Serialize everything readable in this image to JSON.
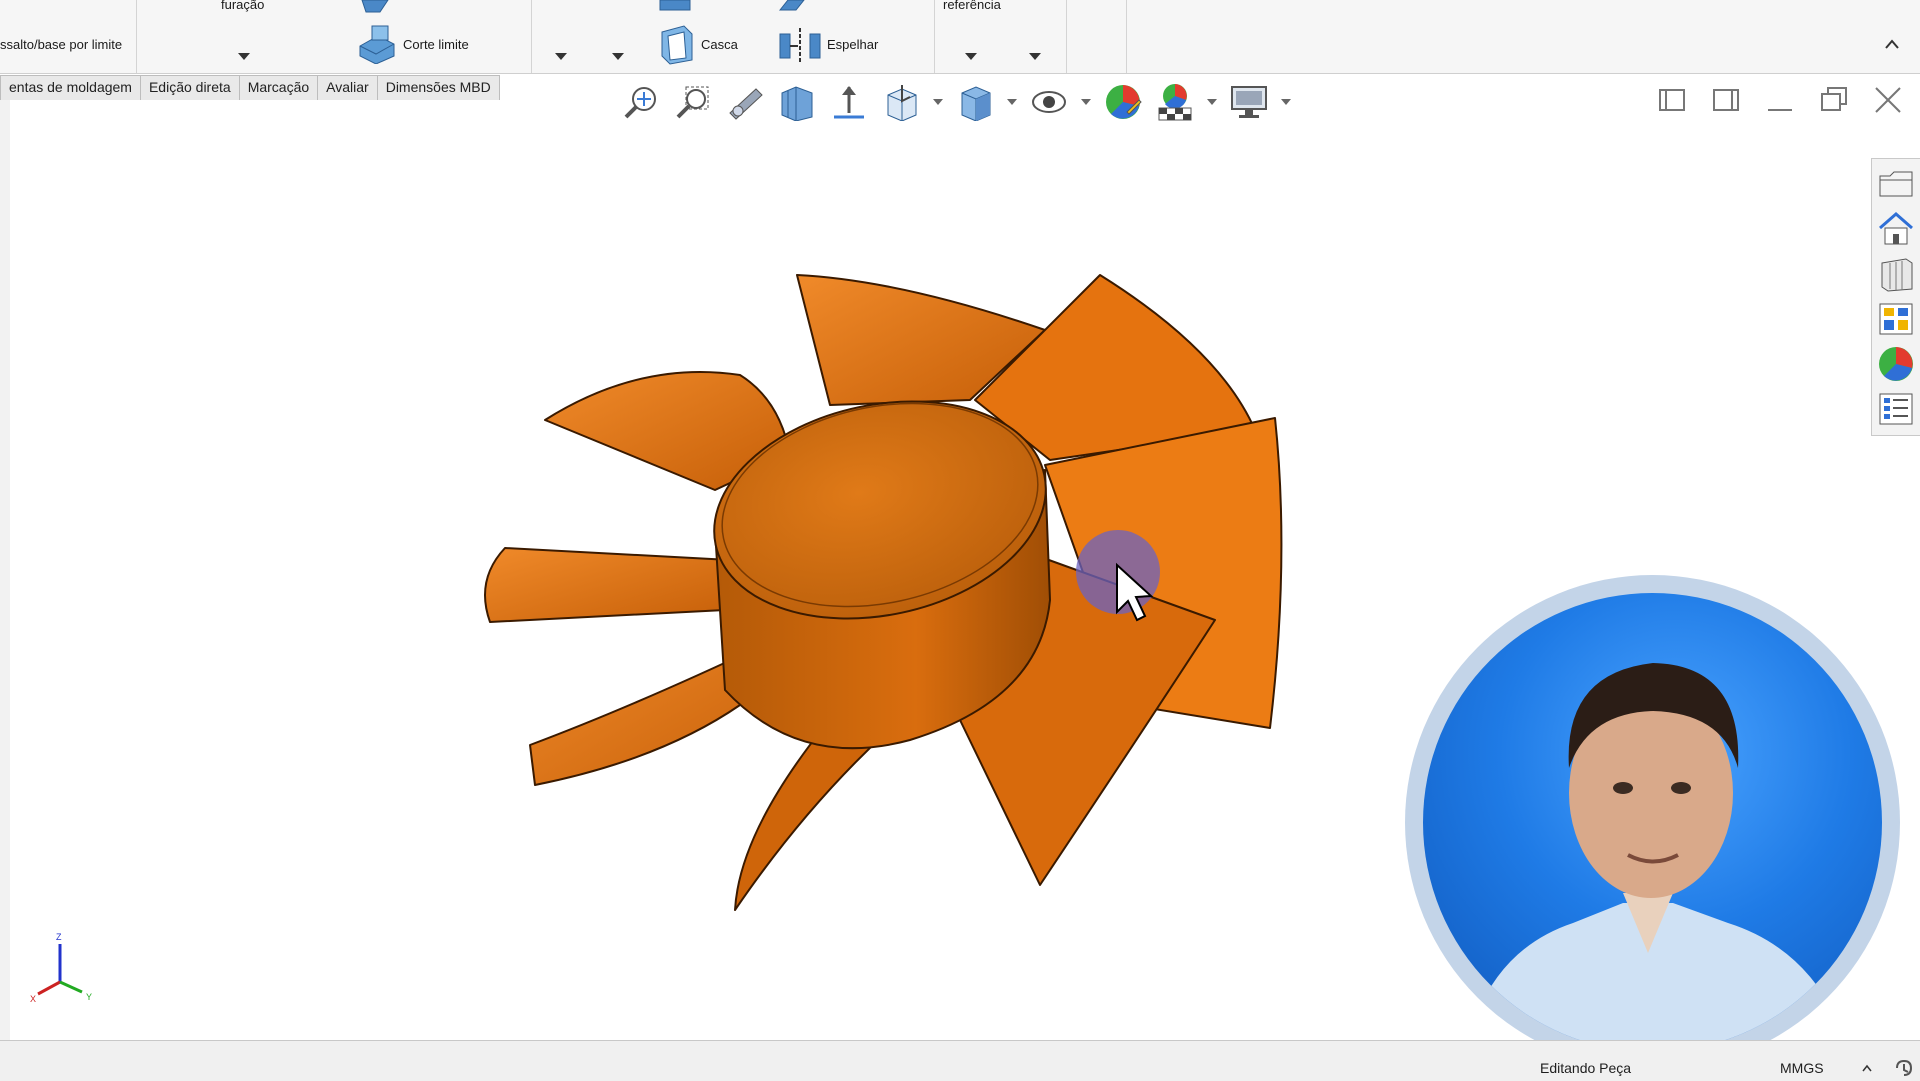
{
  "ribbon": {
    "furacao_label": "furação",
    "ressalto_label": "ssalto/base por limite",
    "corte_limite_label": "Corte limite",
    "casca_label": "Casca",
    "espelhar_label": "Espelhar",
    "referencia_label": "referência"
  },
  "tabs": [
    {
      "label": "entas de moldagem"
    },
    {
      "label": "Edição direta"
    },
    {
      "label": "Marcação"
    },
    {
      "label": "Avaliar"
    },
    {
      "label": "Dimensões MBD"
    }
  ],
  "hud_icons": [
    "zoom-to-fit-icon",
    "zoom-to-area-icon",
    "previous-view-icon",
    "section-view-icon",
    "dynamic-annotation-icon",
    "view-orientation-icon",
    "display-style-icon",
    "hide-show-icon",
    "edit-appearance-icon",
    "apply-scene-icon",
    "view-settings-icon"
  ],
  "taskpane_icons": [
    "file-explorer-icon",
    "solidworks-resources-icon",
    "design-library-icon",
    "view-palette-icon",
    "appearances-icon",
    "custom-properties-icon"
  ],
  "triad": {
    "x": "X",
    "y": "Y",
    "z": "Z"
  },
  "status": {
    "editing": "Editando Peça",
    "units": "MMGS"
  },
  "colors": {
    "part": "#e8720e",
    "part_dark": "#a84d06",
    "accent": "#1a6fd1"
  }
}
